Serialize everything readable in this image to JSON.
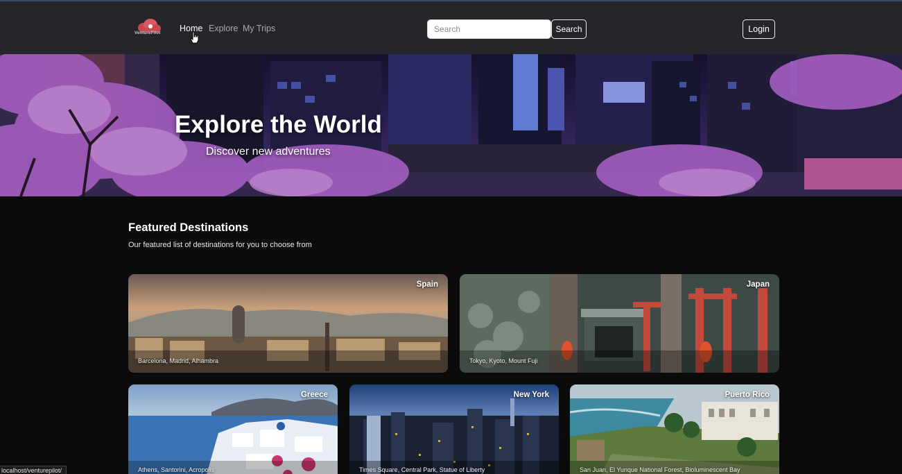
{
  "header": {
    "logo_text": "VenturePilot",
    "nav": [
      {
        "label": "Home"
      },
      {
        "label": "Explore"
      },
      {
        "label": "My Trips"
      }
    ],
    "search": {
      "placeholder": "Search",
      "value": "",
      "button_label": "Search"
    },
    "login_label": "Login"
  },
  "hero": {
    "title": "Explore the World",
    "subtitle": "Discover new adventures"
  },
  "featured": {
    "title": "Featured Destinations",
    "subtitle": "Our featured list of destinations for you to choose from",
    "cards": [
      {
        "name": "Spain",
        "places": "Barcelona, Madrid, Alhambra"
      },
      {
        "name": "Japan",
        "places": "Tokyo, Kyoto, Mount Fuji"
      },
      {
        "name": "Greece",
        "places": "Athens, Santorini, Acropolis"
      },
      {
        "name": "New York",
        "places": "Times Square, Central Park, Statue of Liberty"
      },
      {
        "name": "Puerto Rico",
        "places": "San Juan, El Yunque National Forest, Bioluminescent Bay"
      }
    ]
  },
  "status_bar": {
    "url": "localhost/venturepilot/"
  },
  "colors": {
    "navbar": "#252629",
    "background": "#0b0b0c",
    "accent": "#c9484d"
  }
}
